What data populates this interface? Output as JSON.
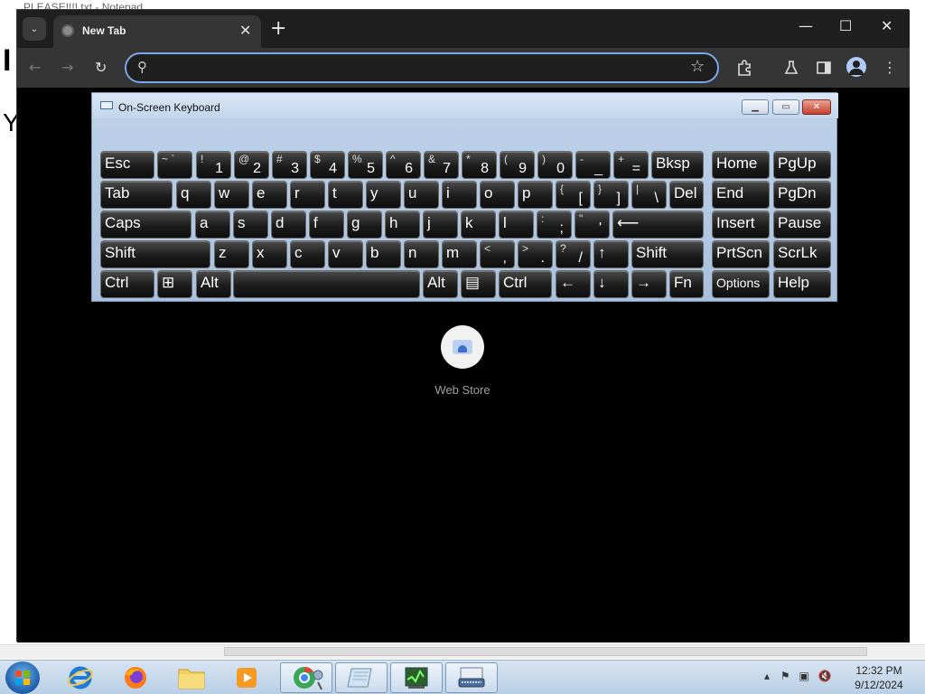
{
  "background_app": {
    "title": "PLEASE!!!!.txt - Notepad",
    "letter1": "I",
    "letter2": "Y"
  },
  "browser": {
    "tab_search_label": "⌄",
    "tab": {
      "title": "New Tab",
      "close": "✕"
    },
    "new_tab": "+",
    "window_controls": {
      "minimize": "—",
      "maximize": "☐",
      "close": "✕"
    },
    "nav": {
      "back": "←",
      "forward": "→",
      "reload": "↻"
    },
    "omnibox": {
      "value": "",
      "placeholder": ""
    },
    "shortcut": {
      "label": "Web Store"
    }
  },
  "osk": {
    "title": "On-Screen Keyboard",
    "rows": [
      [
        {
          "l": "Esc"
        },
        {
          "s": "~ `"
        },
        {
          "s": "!",
          "m": "1"
        },
        {
          "s": "@",
          "m": "2"
        },
        {
          "s": "#",
          "m": "3"
        },
        {
          "s": "$",
          "m": "4"
        },
        {
          "s": "%",
          "m": "5"
        },
        {
          "s": "^",
          "m": "6"
        },
        {
          "s": "&",
          "m": "7"
        },
        {
          "s": "*",
          "m": "8"
        },
        {
          "s": "(",
          "m": "9"
        },
        {
          "s": ")",
          "m": "0"
        },
        {
          "s": "-",
          "m": "_"
        },
        {
          "s": "+",
          "m": "="
        },
        {
          "l": "Bksp"
        },
        {
          "l": "Home"
        },
        {
          "l": "PgUp"
        }
      ],
      [
        {
          "l": "Tab"
        },
        {
          "l": "q"
        },
        {
          "l": "w"
        },
        {
          "l": "e"
        },
        {
          "l": "r"
        },
        {
          "l": "t"
        },
        {
          "l": "y"
        },
        {
          "l": "u"
        },
        {
          "l": "i"
        },
        {
          "l": "o"
        },
        {
          "l": "p"
        },
        {
          "s": "{",
          "m": "["
        },
        {
          "s": "}",
          "m": "]"
        },
        {
          "s": "|",
          "m": "\\"
        },
        {
          "l": "Del"
        },
        {
          "l": "End"
        },
        {
          "l": "PgDn"
        }
      ],
      [
        {
          "l": "Caps"
        },
        {
          "l": "a"
        },
        {
          "l": "s"
        },
        {
          "l": "d"
        },
        {
          "l": "f"
        },
        {
          "l": "g"
        },
        {
          "l": "h"
        },
        {
          "l": "j"
        },
        {
          "l": "k"
        },
        {
          "l": "l"
        },
        {
          "s": ":",
          "m": ";"
        },
        {
          "s": "\"",
          "m": "'"
        },
        {
          "l": "⟵"
        },
        {
          "l": "Insert"
        },
        {
          "l": "Pause"
        }
      ],
      [
        {
          "l": "Shift"
        },
        {
          "l": "z"
        },
        {
          "l": "x"
        },
        {
          "l": "c"
        },
        {
          "l": "v"
        },
        {
          "l": "b"
        },
        {
          "l": "n"
        },
        {
          "l": "m"
        },
        {
          "s": "<",
          "m": ","
        },
        {
          "s": ">",
          "m": "."
        },
        {
          "s": "?",
          "m": "/"
        },
        {
          "l": "↑"
        },
        {
          "l": "Shift"
        },
        {
          "l": "PrtScn"
        },
        {
          "l": "ScrLk"
        }
      ],
      [
        {
          "l": "Ctrl"
        },
        {
          "l": "⊞"
        },
        {
          "l": "Alt"
        },
        {
          "l": ""
        },
        {
          "l": "Alt"
        },
        {
          "l": "▤"
        },
        {
          "l": "Ctrl"
        },
        {
          "l": "←"
        },
        {
          "l": "↓"
        },
        {
          "l": "→"
        },
        {
          "l": "Fn"
        },
        {
          "l": "Options",
          "small": true
        },
        {
          "l": "Help"
        }
      ]
    ]
  },
  "taskbar": {
    "apps": [
      "Internet Explorer",
      "Firefox",
      "Windows Explorer",
      "Media Player",
      "Chrome",
      "Notepad",
      "Task Manager",
      "On-Screen Keyboard"
    ],
    "clock": {
      "time": "12:32 PM",
      "date": "9/12/2024"
    }
  }
}
